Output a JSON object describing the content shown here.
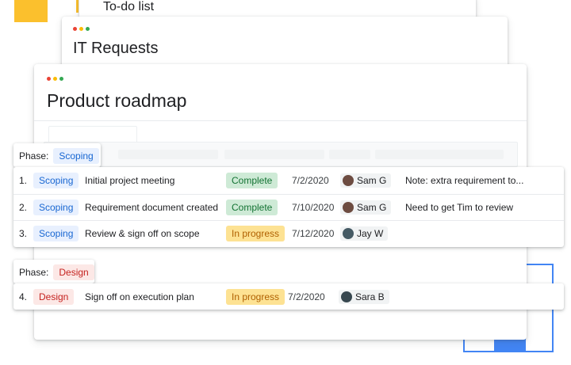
{
  "colors": {
    "dot_red": "#ea4335",
    "dot_yellow": "#fbbc04",
    "dot_green": "#34a853",
    "accent_blue": "#4285f4",
    "accent_yellow": "#fbc02d"
  },
  "windows": {
    "todo": {
      "title": "To-do list"
    },
    "it_requests": {
      "title": "IT Requests"
    },
    "roadmap": {
      "title": "Product roadmap"
    }
  },
  "groups": [
    {
      "phase_label": "Phase:",
      "phase_name": "Scoping",
      "phase_color": "blue",
      "rows": [
        {
          "num": "1.",
          "phase": "Scoping",
          "task": "Initial project meeting",
          "status": "Complete",
          "status_kind": "green",
          "date": "7/2/2020",
          "person": "Sam G",
          "avatar_icon": "person-avatar-icon",
          "note": "Note: extra requirement to..."
        },
        {
          "num": "2.",
          "phase": "Scoping",
          "task": "Requirement document created",
          "status": "Complete",
          "status_kind": "green",
          "date": "7/10/2020",
          "person": "Sam G",
          "avatar_icon": "person-avatar-icon",
          "note": "Need to get Tim to review"
        },
        {
          "num": "3.",
          "phase": "Scoping",
          "task": "Review & sign off on scope",
          "status": "In progress",
          "status_kind": "orange",
          "date": "7/12/2020",
          "person": "Jay W",
          "avatar_icon": "person-avatar-icon",
          "note": ""
        }
      ]
    },
    {
      "phase_label": "Phase:",
      "phase_name": "Design",
      "phase_color": "red",
      "rows": [
        {
          "num": "4.",
          "phase": "Design",
          "task": "Sign off on execution plan",
          "status": "In progress",
          "status_kind": "orange",
          "date": "7/2/2020",
          "person": "Sara B",
          "avatar_icon": "person-avatar-icon",
          "note": ""
        }
      ]
    }
  ]
}
